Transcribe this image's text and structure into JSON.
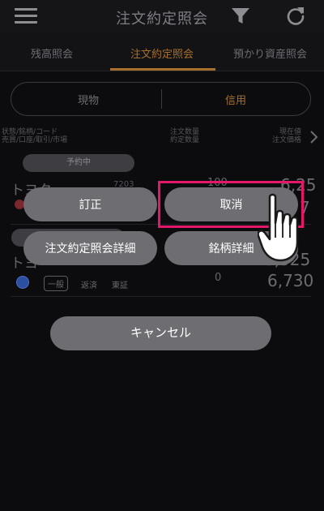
{
  "header": {
    "title": "注文約定照会",
    "menu_icon": "hamburger-icon",
    "filter_icon": "filter-icon",
    "refresh_icon": "refresh-icon"
  },
  "tabs": [
    {
      "label": "残高照会",
      "active": false
    },
    {
      "label": "注文約定照会",
      "active": true
    },
    {
      "label": "預かり資産照会",
      "active": false
    }
  ],
  "segment": {
    "options": [
      "現物",
      "信用"
    ],
    "selected": "信用"
  },
  "columns": {
    "left_line1": "状態/銘柄/コード",
    "left_line2": "売買/口座/取引/市場",
    "mid_line1": "注文数量",
    "mid_line2": "約定数量",
    "right_line1": "現在値",
    "right_line2": "注文価格"
  },
  "rows": [
    {
      "status": "予約中",
      "name": "トヨタ",
      "time": "7203",
      "order_qty": "100",
      "price_partial_1": "6,25",
      "price_partial_2": "7"
    },
    {
      "name": "トヨ",
      "account": "一般",
      "trade": "返済",
      "market": "東証",
      "filled_qty": "0",
      "current_price": "6,525",
      "order_price": "6,730"
    }
  ],
  "actions": {
    "correct": "訂正",
    "cancel_order": "取消",
    "order_detail": "注文約定照会詳細",
    "stock_detail": "銘柄詳細",
    "close": "キャンセル"
  },
  "colors": {
    "accent": "#a7702c",
    "highlight": "#e5176a",
    "button": "#6d6d72"
  }
}
